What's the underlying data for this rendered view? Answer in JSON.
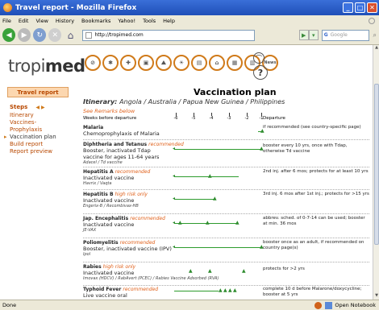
{
  "window": {
    "title": "Travel report - Mozilla Firefox"
  },
  "menu": [
    "File",
    "Edit",
    "View",
    "History",
    "Bookmarks",
    "Yahoo!",
    "Tools",
    "Help"
  ],
  "nav": {
    "url": "http://tropimed.com",
    "search_placeholder": "Google"
  },
  "logo": {
    "brand_light": "tropi",
    "brand_bold": "med",
    "mark": "®"
  },
  "categories": [
    {
      "name": "vaccination-icon",
      "glyph": "⊘"
    },
    {
      "name": "malaria-icon",
      "glyph": "✱"
    },
    {
      "name": "first-aid-icon",
      "glyph": "✚"
    },
    {
      "name": "kit-icon",
      "glyph": "▣"
    },
    {
      "name": "mountain-icon",
      "glyph": "⛰"
    },
    {
      "name": "sun-icon",
      "glyph": "☀"
    },
    {
      "name": "map-icon",
      "glyph": "▤"
    },
    {
      "name": "home-icon",
      "glyph": "⌂"
    },
    {
      "name": "document-icon",
      "glyph": "▦"
    },
    {
      "name": "book-icon",
      "glyph": "▥"
    },
    {
      "name": "news-icon",
      "glyph": "News"
    }
  ],
  "sidebar": {
    "tab": "Travel report",
    "steps_label": "Steps",
    "steps": [
      "Itinerary",
      "Vaccines-\nProphylaxis",
      "Vaccination plan",
      "Build report",
      "Report preview"
    ]
  },
  "main": {
    "title": "Vaccination plan",
    "itinerary_label": "Itinerary:",
    "itinerary": "Angola / Australia / Papua New Guinea / Philippines",
    "remarks": "See Remarks below",
    "weeks_label": "Weeks before departure",
    "departure_label": "Departure",
    "ticks": [
      "-6",
      "-5",
      "-4",
      "-3",
      "-2",
      "-1"
    ],
    "vaccines": [
      {
        "name": "Malaria",
        "rec": "",
        "sub": "Chemoprophylaxis of Malaria",
        "small": "",
        "note": "if recommended (see country-specific page)"
      },
      {
        "name": "Diphtheria and Tetanus",
        "rec": "recommended",
        "sub": "Booster, inactivated Tdap vaccine for ages 11-64 years",
        "small": "Adacel / Td vaccine",
        "note": "booster every 10 yrs, once with Tdap, otherwise Td vaccine"
      },
      {
        "name": "Hepatitis A",
        "rec": "recommended",
        "sub": "Inactivated vaccine",
        "small": "Havrix / Vaqta",
        "note": "2nd inj. after 6 mos; protects for at least 10 yrs"
      },
      {
        "name": "Hepatitis B",
        "rec": "high risk only",
        "sub": "Inactivated vaccine",
        "small": "Engerix-B / Recombivax-HB",
        "note": "3rd inj. 6 mos after 1st inj.; protects for >15 yrs"
      },
      {
        "name": "Jap. Encephalitis",
        "rec": "recommended",
        "sub": "Inactivated vaccine",
        "small": "JE-VAX",
        "note": "abbrev. sched. of 0-7-14 can be used; booster at min. 36 mos"
      },
      {
        "name": "Poliomyelitis",
        "rec": "recommended",
        "sub": "Booster, inactivated vaccine (IPV)",
        "small": "Ipol",
        "note": "booster once as an adult, if recommended on country page(s)"
      },
      {
        "name": "Rabies",
        "rec": "high risk only",
        "sub": "Inactivated vaccine",
        "small": "Imovax (HDCV) / RabAvert (PCEC) / Rabies Vaccine Adsorbed (RVA)",
        "note": "protects for >2 yrs"
      },
      {
        "name": "Typhoid Fever",
        "rec": "recommended",
        "sub": "Live vaccine oral",
        "small": "",
        "note": "complete 10 d before Malarone/doxycycline; booster at 5 yrs"
      }
    ]
  },
  "status": {
    "text": "Done",
    "right": "Open Notebook"
  }
}
